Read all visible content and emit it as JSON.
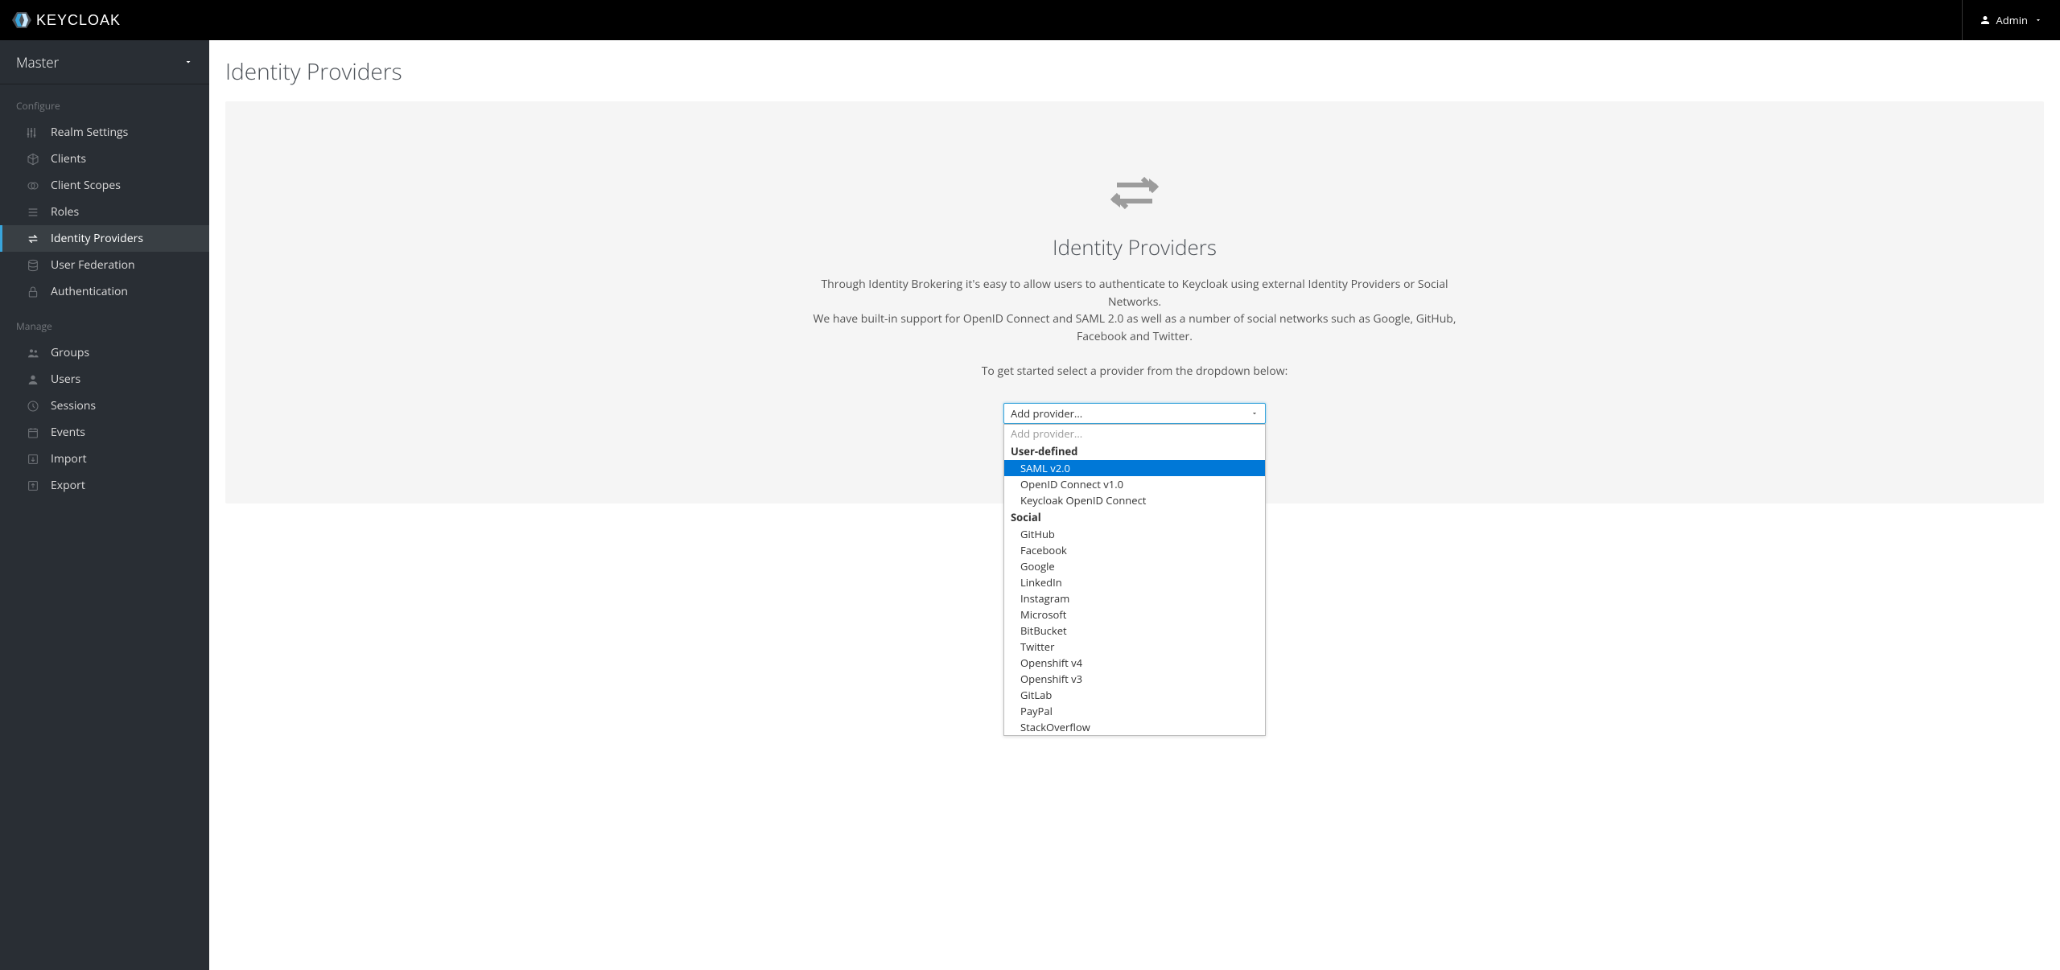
{
  "header": {
    "brand": "KEYCLOAK",
    "user_label": "Admin"
  },
  "sidebar": {
    "realm": "Master",
    "sections": [
      {
        "label": "Configure",
        "items": [
          {
            "icon": "sliders",
            "label": "Realm Settings",
            "active": false
          },
          {
            "icon": "cube",
            "label": "Clients",
            "active": false
          },
          {
            "icon": "venn",
            "label": "Client Scopes",
            "active": false
          },
          {
            "icon": "list",
            "label": "Roles",
            "active": false
          },
          {
            "icon": "exchange",
            "label": "Identity Providers",
            "active": true
          },
          {
            "icon": "db",
            "label": "User Federation",
            "active": false
          },
          {
            "icon": "lock",
            "label": "Authentication",
            "active": false
          }
        ]
      },
      {
        "label": "Manage",
        "items": [
          {
            "icon": "group",
            "label": "Groups",
            "active": false
          },
          {
            "icon": "user",
            "label": "Users",
            "active": false
          },
          {
            "icon": "clock",
            "label": "Sessions",
            "active": false
          },
          {
            "icon": "calendar",
            "label": "Events",
            "active": false
          },
          {
            "icon": "import",
            "label": "Import",
            "active": false
          },
          {
            "icon": "export",
            "label": "Export",
            "active": false
          }
        ]
      }
    ]
  },
  "main": {
    "title": "Identity Providers",
    "empty": {
      "heading": "Identity Providers",
      "line1": "Through Identity Brokering it's easy to allow users to authenticate to Keycloak using external Identity Providers or Social Networks.",
      "line2": "We have built-in support for OpenID Connect and SAML 2.0 as well as a number of social networks such as Google, GitHub, Facebook and Twitter.",
      "hint": "To get started select a provider from the dropdown below:"
    },
    "dropdown": {
      "placeholder": "Add provider...",
      "groups": [
        {
          "label": "User-defined",
          "options": [
            {
              "label": "SAML v2.0",
              "highlight": true
            },
            {
              "label": "OpenID Connect v1.0",
              "highlight": false
            },
            {
              "label": "Keycloak OpenID Connect",
              "highlight": false
            }
          ]
        },
        {
          "label": "Social",
          "options": [
            {
              "label": "GitHub",
              "highlight": false
            },
            {
              "label": "Facebook",
              "highlight": false
            },
            {
              "label": "Google",
              "highlight": false
            },
            {
              "label": "LinkedIn",
              "highlight": false
            },
            {
              "label": "Instagram",
              "highlight": false
            },
            {
              "label": "Microsoft",
              "highlight": false
            },
            {
              "label": "BitBucket",
              "highlight": false
            },
            {
              "label": "Twitter",
              "highlight": false
            },
            {
              "label": "Openshift v4",
              "highlight": false
            },
            {
              "label": "Openshift v3",
              "highlight": false
            },
            {
              "label": "GitLab",
              "highlight": false
            },
            {
              "label": "PayPal",
              "highlight": false
            },
            {
              "label": "StackOverflow",
              "highlight": false
            }
          ]
        }
      ]
    }
  }
}
